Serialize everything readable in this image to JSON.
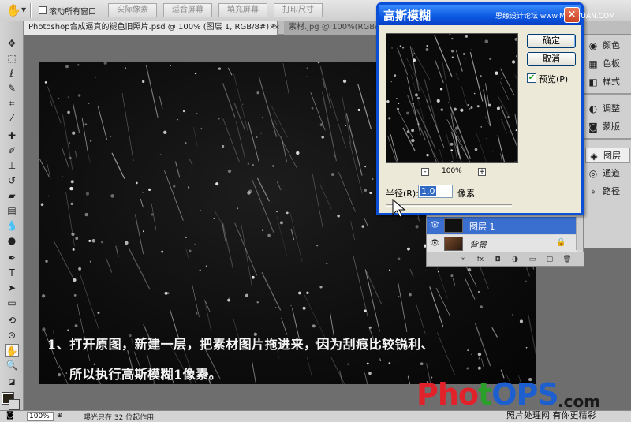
{
  "options_bar": {
    "hand_icon": "hand-icon",
    "scroll_all_windows_label": "滚动所有窗口",
    "scroll_all_windows_checked": false,
    "buttons": [
      "实际像素",
      "适合屏幕",
      "填充屏幕",
      "打印尺寸"
    ]
  },
  "tabs": [
    {
      "label": "Photoshop合成逼真的褪色旧照片.psd @ 100% (图层 1, RGB/8#) *",
      "close": "×"
    },
    {
      "label": "素材.jpg @ 100%(RGB/8#) *",
      "close": "×"
    }
  ],
  "caption": {
    "line1": "1、打开原图，新建一层，把素材图片拖进来，因为刮痕比较锐利、",
    "line2": "所以执行高斯模糊1像素。"
  },
  "panels": [
    {
      "label": "颜色",
      "icon": "color-wheel-icon"
    },
    {
      "label": "色板",
      "icon": "swatches-icon"
    },
    {
      "label": "样式",
      "icon": "styles-icon"
    },
    {
      "label": "调整",
      "icon": "adjustments-icon"
    },
    {
      "label": "蒙版",
      "icon": "masks-icon"
    },
    {
      "label": "图层",
      "icon": "layers-icon"
    },
    {
      "label": "通道",
      "icon": "channels-icon"
    },
    {
      "label": "路径",
      "icon": "paths-icon"
    }
  ],
  "layers": [
    {
      "name": "图层 1",
      "selected": true
    },
    {
      "name": "背景",
      "selected": false,
      "locked": true
    }
  ],
  "dialog": {
    "title": "高斯模糊",
    "watermark": "思缘设计论坛 www.MISSYUAN.COM",
    "close": "×",
    "ok_label": "确定",
    "cancel_label": "取消",
    "preview_label": "预览(P)",
    "preview_checked": true,
    "zoom_label": "100%",
    "zoom_minus": "-",
    "zoom_plus": "+",
    "radius_label": "半径(R):",
    "radius_value": "1.0",
    "radius_unit": "像素"
  },
  "status_bar": {
    "zoom": "100%",
    "info": "曝光只在 32 位起作用"
  },
  "branding": {
    "logo_a": "Pho",
    "logo_b": "t",
    "logo_c": "OPS",
    "logo_com": ".com",
    "tagline": "照片处理网 有你更精彩"
  },
  "colors": {
    "dialog_title": "#0a56e0",
    "selected_layer": "#3a6fd0",
    "brand_red": "#e2222a",
    "brand_blue": "#1e5fd0"
  }
}
